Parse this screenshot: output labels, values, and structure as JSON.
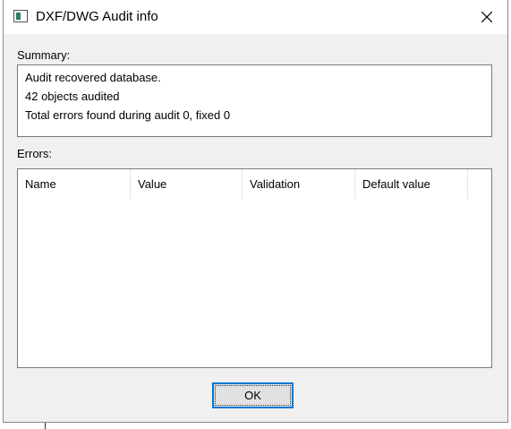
{
  "window": {
    "title": "DXF/DWG Audit info",
    "icon": "window-app-icon",
    "close_icon": "close-icon"
  },
  "summary": {
    "label": "Summary:",
    "lines": [
      "Audit recovered database.",
      "42 objects audited",
      "Total errors found during audit 0, fixed 0"
    ]
  },
  "errors": {
    "label": "Errors:",
    "columns": [
      "Name",
      "Value",
      "Validation",
      "Default value"
    ],
    "rows": []
  },
  "buttons": {
    "ok_label": "OK"
  },
  "colors": {
    "focus_border": "#0078d7",
    "dialog_background": "#f0f0f0"
  }
}
